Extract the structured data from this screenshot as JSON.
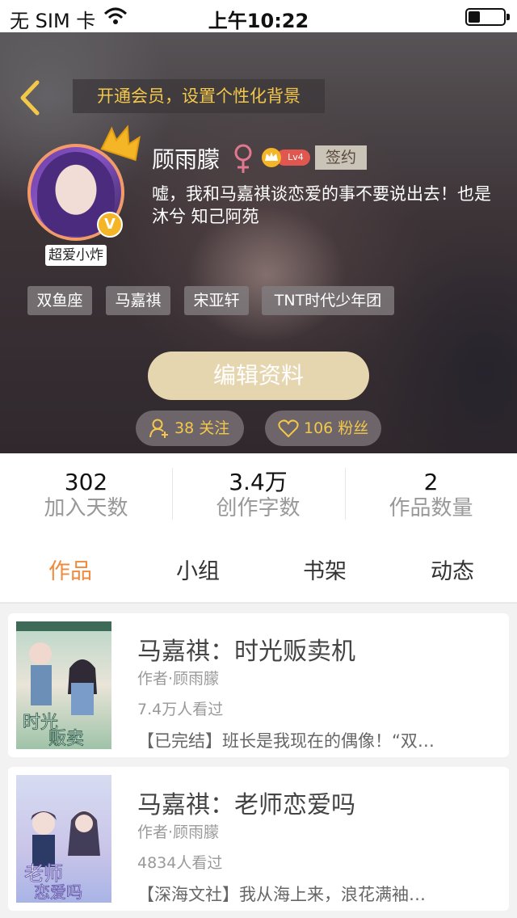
{
  "status_bar": {
    "carrier": "无 SIM 卡",
    "time": "上午10:22",
    "wifi_icon": "wifi-icon",
    "battery_icon": "battery-icon"
  },
  "header": {
    "back_icon": "chevron-left-icon",
    "vip_banner": "开通会员，设置个性化背景"
  },
  "profile": {
    "avatar_tag": "超爱小炸",
    "v_badge": "V",
    "name": "顾雨朦",
    "gender_icon": "female-icon",
    "level": "Lv4",
    "sign_tag": "签约",
    "bio": "嘘，我和马嘉祺谈恋爱的事不要说出去！也是沐兮 知己阿苑",
    "tags": [
      "双鱼座",
      "马嘉祺",
      "宋亚轩",
      "TNT时代少年团"
    ],
    "edit_button": "编辑资料",
    "following": "38 关注",
    "followers": "106 粉丝"
  },
  "stats": [
    {
      "value": "302",
      "label": "加入天数"
    },
    {
      "value": "3.4万",
      "label": "创作字数"
    },
    {
      "value": "2",
      "label": "作品数量"
    }
  ],
  "tabs": [
    {
      "label": "作品",
      "active": true
    },
    {
      "label": "小组",
      "active": false
    },
    {
      "label": "书架",
      "active": false
    },
    {
      "label": "动态",
      "active": false
    }
  ],
  "works": [
    {
      "title": "马嘉祺：时光贩卖机",
      "author": "作者·顾雨朦",
      "views": "7.4万人看过",
      "desc": "【已完结】班长是我现在的偶像！“双…"
    },
    {
      "title": "马嘉祺：老师恋爱吗",
      "author": "作者·顾雨朦",
      "views": "4834人看过",
      "desc": "【深海文社】我从海上来，浪花满袖…"
    }
  ],
  "colors": {
    "accent_orange": "#f08a3c",
    "vip_gold": "#f3c84a",
    "edit_button_bg": "#e6d6b0",
    "avatar_ring": "#f39a6a"
  }
}
